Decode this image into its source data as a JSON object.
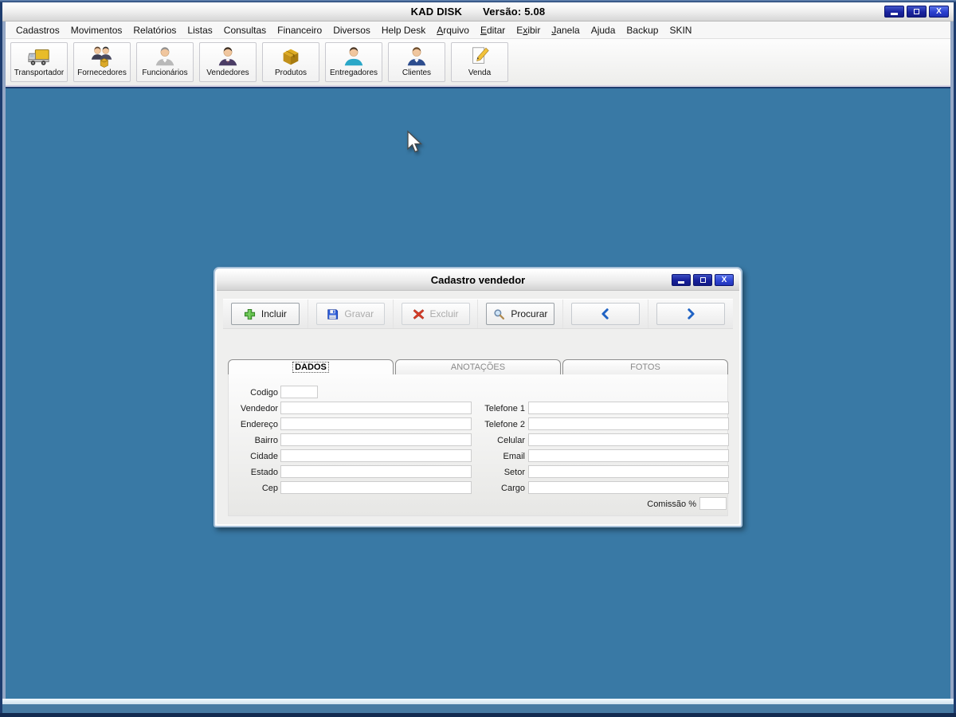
{
  "window": {
    "title": "KAD DISK",
    "version": "Versão: 5.08",
    "controls": {
      "minimize": "–",
      "close": "X"
    }
  },
  "menu": {
    "items": [
      {
        "label": "Cadastros"
      },
      {
        "label": "Movimentos"
      },
      {
        "label": "Relatórios"
      },
      {
        "label": "Listas"
      },
      {
        "label": "Consultas"
      },
      {
        "label": "Financeiro"
      },
      {
        "label": "Diversos"
      },
      {
        "label": "Help Desk"
      },
      {
        "label": "Arquivo",
        "underline": 0
      },
      {
        "label": "Editar",
        "underline": 0
      },
      {
        "label": "Exibir",
        "underline": 1
      },
      {
        "label": "Janela",
        "underline": 0
      },
      {
        "label": "Ajuda"
      },
      {
        "label": "Backup"
      },
      {
        "label": "SKIN"
      }
    ]
  },
  "toolbar": {
    "items": [
      {
        "label": "Transportador",
        "icon": "truck-icon"
      },
      {
        "label": "Fornecedores",
        "icon": "suppliers-icon"
      },
      {
        "label": "Funcionários",
        "icon": "employee-icon"
      },
      {
        "label": "Vendedores",
        "icon": "salesman-icon"
      },
      {
        "label": "Produtos",
        "icon": "product-box-icon"
      },
      {
        "label": "Entregadores",
        "icon": "courier-icon"
      },
      {
        "label": "Clientes",
        "icon": "client-icon"
      },
      {
        "label": "Venda",
        "icon": "sale-pencil-icon"
      }
    ]
  },
  "dialog": {
    "title": "Cadastro vendedor",
    "controls": {
      "minimize": "–",
      "close": "X"
    },
    "buttons": [
      {
        "label": "Incluir",
        "icon": "plus-icon",
        "disabled": false
      },
      {
        "label": "Gravar",
        "icon": "save-icon",
        "disabled": true
      },
      {
        "label": "Excluir",
        "icon": "delete-icon",
        "disabled": true
      },
      {
        "label": "Procurar",
        "icon": "search-icon",
        "disabled": false
      }
    ],
    "tabs": [
      {
        "label": "DADOS",
        "active": true
      },
      {
        "label": "ANOTAÇÕES",
        "active": false
      },
      {
        "label": "FOTOS",
        "active": false
      }
    ],
    "form": {
      "left": [
        {
          "label": "Codigo",
          "value": ""
        },
        {
          "label": "Vendedor",
          "value": ""
        },
        {
          "label": "Endereço",
          "value": ""
        },
        {
          "label": "Bairro",
          "value": ""
        },
        {
          "label": "Cidade",
          "value": ""
        },
        {
          "label": "Estado",
          "value": ""
        },
        {
          "label": "Cep",
          "value": ""
        }
      ],
      "right": [
        {
          "label": "Telefone 1",
          "value": ""
        },
        {
          "label": "Telefone 2",
          "value": ""
        },
        {
          "label": "Celular",
          "value": ""
        },
        {
          "label": "Email",
          "value": ""
        },
        {
          "label": "Setor",
          "value": ""
        },
        {
          "label": "Cargo",
          "value": ""
        }
      ],
      "comissao": {
        "label": "Comissão %",
        "value": ""
      }
    }
  },
  "colors": {
    "mdi_background": "#3979A5",
    "titlebar_button_navy": "#1a23a0",
    "titlebar_button_close": "#2f46d4",
    "frame_navy": "#1d3c6e"
  }
}
